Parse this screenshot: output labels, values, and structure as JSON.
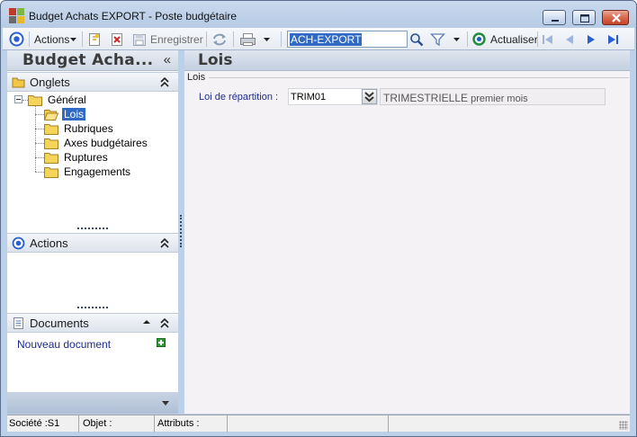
{
  "window": {
    "title": "Budget Achats EXPORT -  Poste budgétaire"
  },
  "toolbar": {
    "actions_label": "Actions",
    "save_label": "Enregistrer",
    "search_value": "ACH-EXPORT",
    "refresh_label": "Actualiser"
  },
  "left_panel": {
    "title": "Budget Acha...",
    "collapse_glyph": "«",
    "onglets_label": "Onglets",
    "tree": {
      "root": "Général",
      "children": [
        "Lois",
        "Rubriques",
        "Axes budgétaires",
        "Ruptures",
        "Engagements"
      ]
    },
    "actions_label": "Actions",
    "documents_label": "Documents",
    "new_document_label": "Nouveau document"
  },
  "main": {
    "title": "Lois",
    "group_label": "Lois",
    "field_label": "Loi de répartition :",
    "field_value": "TRIM01",
    "field_desc_code": "TRIMESTRIELLE",
    "field_desc_detail": "premier mois"
  },
  "statusbar": {
    "societe": "Société :S1",
    "objet": "Objet :",
    "attributs": "Attributs :"
  },
  "colors": {
    "selection": "#316ac5",
    "link": "#1b2c8f",
    "accent_blue": "#2a5fd0",
    "add_green": "#2f9a35"
  }
}
